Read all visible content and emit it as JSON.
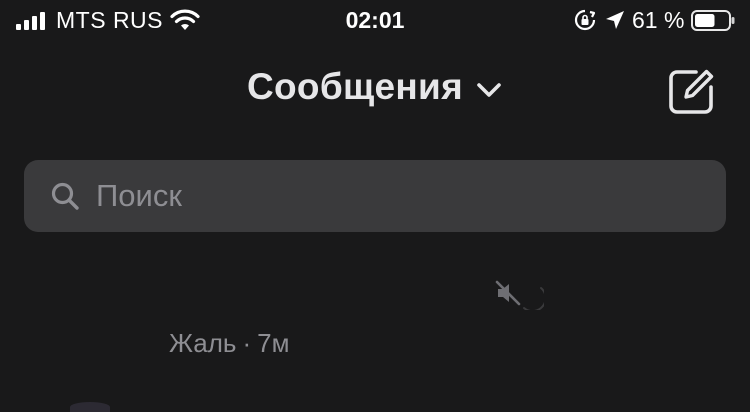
{
  "status_bar": {
    "carrier": "MTS RUS",
    "time": "02:01",
    "battery_percent": "61 %",
    "battery_level": 0.61,
    "signal_bars": 4,
    "icons": [
      "signal-icon",
      "wifi-icon",
      "orientation-lock-icon",
      "location-arrow-icon",
      "battery-icon"
    ]
  },
  "header": {
    "title": "Сообщения",
    "title_icon": "chevron-down-icon",
    "compose_icon": "compose-icon"
  },
  "search": {
    "placeholder": "Поиск",
    "value": "",
    "icon": "search-icon"
  },
  "conversation": {
    "preview_text": "Жаль",
    "separator": "·",
    "time": "7м",
    "muted": true,
    "icons": [
      "muted-icon",
      "loading-spinner-icon"
    ]
  },
  "colors": {
    "background": "#19191a",
    "search_bg": "#3a3a3c",
    "primary_text": "#e6e6e8",
    "secondary_text": "#8e8e93"
  }
}
